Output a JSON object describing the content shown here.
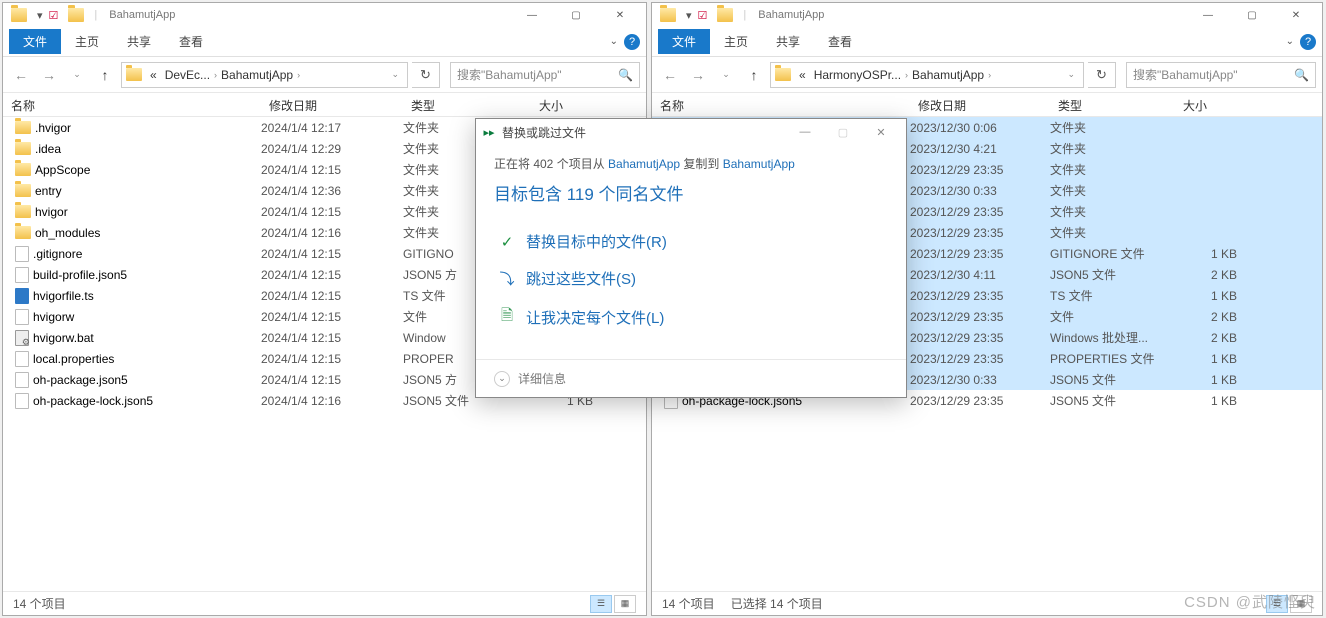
{
  "watermark": "CSDN @武陵悭臾",
  "leftWindow": {
    "title": "BahamutjApp",
    "ribbon": {
      "file": "文件",
      "home": "主页",
      "share": "共享",
      "view": "查看"
    },
    "breadcrumb": [
      {
        "label": "«"
      },
      {
        "label": "DevEc..."
      },
      {
        "label": "BahamutjApp"
      }
    ],
    "searchPlaceholder": "搜索\"BahamutjApp\"",
    "columns": {
      "name": "名称",
      "date": "修改日期",
      "type": "类型",
      "size": "大小"
    },
    "items": [
      {
        "icon": "folder",
        "name": ".hvigor",
        "date": "2024/1/4 12:17",
        "type": "文件夹",
        "size": ""
      },
      {
        "icon": "folder",
        "name": ".idea",
        "date": "2024/1/4 12:29",
        "type": "文件夹",
        "size": ""
      },
      {
        "icon": "folder",
        "name": "AppScope",
        "date": "2024/1/4 12:15",
        "type": "文件夹",
        "size": ""
      },
      {
        "icon": "folder",
        "name": "entry",
        "date": "2024/1/4 12:36",
        "type": "文件夹",
        "size": ""
      },
      {
        "icon": "folder",
        "name": "hvigor",
        "date": "2024/1/4 12:15",
        "type": "文件夹",
        "size": ""
      },
      {
        "icon": "folder",
        "name": "oh_modules",
        "date": "2024/1/4 12:16",
        "type": "文件夹",
        "size": ""
      },
      {
        "icon": "file",
        "name": ".gitignore",
        "date": "2024/1/4 12:15",
        "type": "GITIGNO",
        "size": ""
      },
      {
        "icon": "file",
        "name": "build-profile.json5",
        "date": "2024/1/4 12:15",
        "type": "JSON5 方",
        "size": ""
      },
      {
        "icon": "ts",
        "name": "hvigorfile.ts",
        "date": "2024/1/4 12:15",
        "type": "TS 文件",
        "size": ""
      },
      {
        "icon": "file",
        "name": "hvigorw",
        "date": "2024/1/4 12:15",
        "type": "文件",
        "size": ""
      },
      {
        "icon": "bat",
        "name": "hvigorw.bat",
        "date": "2024/1/4 12:15",
        "type": "Window",
        "size": ""
      },
      {
        "icon": "file",
        "name": "local.properties",
        "date": "2024/1/4 12:15",
        "type": "PROPER",
        "size": ""
      },
      {
        "icon": "file",
        "name": "oh-package.json5",
        "date": "2024/1/4 12:15",
        "type": "JSON5 方",
        "size": ""
      },
      {
        "icon": "file",
        "name": "oh-package-lock.json5",
        "date": "2024/1/4 12:16",
        "type": "JSON5 文件",
        "size": "1 KB"
      }
    ],
    "status": "14 个项目"
  },
  "rightWindow": {
    "title": "BahamutjApp",
    "ribbon": {
      "file": "文件",
      "home": "主页",
      "share": "共享",
      "view": "查看"
    },
    "breadcrumb": [
      {
        "label": "«"
      },
      {
        "label": "HarmonyOSPr..."
      },
      {
        "label": "BahamutjApp"
      }
    ],
    "searchPlaceholder": "搜索\"BahamutjApp\"",
    "columns": {
      "name": "名称",
      "date": "修改日期",
      "type": "类型",
      "size": "大小"
    },
    "items": [
      {
        "icon": "folder",
        "name": "",
        "date": "2023/12/30 0:06",
        "type": "文件夹",
        "size": "",
        "sel": true
      },
      {
        "icon": "folder",
        "name": "",
        "date": "2023/12/30 4:21",
        "type": "文件夹",
        "size": "",
        "sel": true
      },
      {
        "icon": "folder",
        "name": "",
        "date": "2023/12/29 23:35",
        "type": "文件夹",
        "size": "",
        "sel": true
      },
      {
        "icon": "folder",
        "name": "",
        "date": "2023/12/30 0:33",
        "type": "文件夹",
        "size": "",
        "sel": true
      },
      {
        "icon": "folder",
        "name": "",
        "date": "2023/12/29 23:35",
        "type": "文件夹",
        "size": "",
        "sel": true
      },
      {
        "icon": "folder",
        "name": "",
        "date": "2023/12/29 23:35",
        "type": "文件夹",
        "size": "",
        "sel": true
      },
      {
        "icon": "file",
        "name": "",
        "date": "2023/12/29 23:35",
        "type": "GITIGNORE 文件",
        "size": "1 KB",
        "sel": true
      },
      {
        "icon": "file",
        "name": "",
        "date": "2023/12/30 4:11",
        "type": "JSON5 文件",
        "size": "2 KB",
        "sel": true
      },
      {
        "icon": "ts",
        "name": "",
        "date": "2023/12/29 23:35",
        "type": "TS 文件",
        "size": "1 KB",
        "sel": true
      },
      {
        "icon": "file",
        "name": "",
        "date": "2023/12/29 23:35",
        "type": "文件",
        "size": "2 KB",
        "sel": true
      },
      {
        "icon": "bat",
        "name": "",
        "date": "2023/12/29 23:35",
        "type": "Windows 批处理...",
        "size": "2 KB",
        "sel": true
      },
      {
        "icon": "file",
        "name": "",
        "date": "2023/12/29 23:35",
        "type": "PROPERTIES 文件",
        "size": "1 KB",
        "sel": true
      },
      {
        "icon": "file",
        "name": "",
        "date": "2023/12/30 0:33",
        "type": "JSON5 文件",
        "size": "1 KB",
        "sel": true
      },
      {
        "icon": "file",
        "name": "oh-package-lock.json5",
        "date": "2023/12/29 23:35",
        "type": "JSON5 文件",
        "size": "1 KB",
        "sel": false
      }
    ],
    "status": "14 个项目",
    "statusSel": "已选择 14 个项目"
  },
  "dialog": {
    "title": "替换或跳过文件",
    "copyingPrefix": "正在将 402 个项目从 ",
    "copyingSrc": "BahamutjApp",
    "copyingMid": " 复制到 ",
    "copyingDst": "BahamutjApp",
    "heading": "目标包含 119 个同名文件",
    "optReplace": "替换目标中的文件(R)",
    "optSkip": "跳过这些文件(S)",
    "optDecide": "让我决定每个文件(L)",
    "more": "详细信息"
  }
}
